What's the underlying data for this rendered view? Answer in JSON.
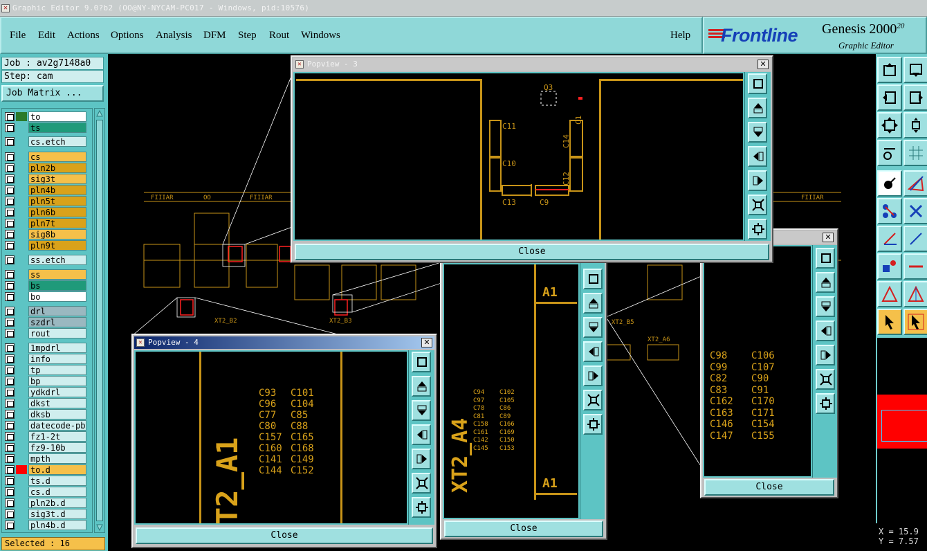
{
  "window": {
    "title": "Graphic Editor 9.0?b2  (OO@NY-NYCAM-PC017 - Windows, pid:10576)"
  },
  "menu": {
    "items": [
      "File",
      "Edit",
      "Actions",
      "Options",
      "Analysis",
      "DFM",
      "Step",
      "Rout",
      "Windows"
    ],
    "help": "Help"
  },
  "brand": {
    "logo": "Frontline",
    "product": "Genesis 2000",
    "product_suffix": "20",
    "subtitle": "Graphic Editor"
  },
  "job": {
    "job_label": "Job : av2g7148a0",
    "step_label": "Step: cam",
    "matrix_button": "Job Matrix ..."
  },
  "layers": [
    {
      "name": "to",
      "color": "#ffffff"
    },
    {
      "name": "ts",
      "color": "#1f9a7a"
    },
    {
      "name": "cs.etch",
      "color": "#cfeeee"
    },
    {
      "name": "cs",
      "color": "#f5c04a"
    },
    {
      "name": "pln2b",
      "color": "#d9a21a"
    },
    {
      "name": "sig3t",
      "color": "#f5c04a"
    },
    {
      "name": "pln4b",
      "color": "#d9a21a"
    },
    {
      "name": "pln5t",
      "color": "#d9a21a"
    },
    {
      "name": "pln6b",
      "color": "#d9a21a"
    },
    {
      "name": "pln7t",
      "color": "#d9a21a"
    },
    {
      "name": "sig8b",
      "color": "#f5c04a"
    },
    {
      "name": "pln9t",
      "color": "#d9a21a"
    },
    {
      "name": "ss.etch",
      "color": "#cfeeee"
    },
    {
      "name": "ss",
      "color": "#f5c04a"
    },
    {
      "name": "bs",
      "color": "#1f9a7a"
    },
    {
      "name": "bo",
      "color": "#ffffff"
    },
    {
      "name": "drl",
      "color": "#9ab8c0"
    },
    {
      "name": "szdrl",
      "color": "#9ab8c0"
    },
    {
      "name": "rout",
      "color": "#cfeeee"
    },
    {
      "name": "1mpdrl",
      "color": "#cfeeee"
    },
    {
      "name": "info",
      "color": "#cfeeee"
    },
    {
      "name": "tp",
      "color": "#cfeeee"
    },
    {
      "name": "bp",
      "color": "#cfeeee"
    },
    {
      "name": "ydkdrl",
      "color": "#cfeeee"
    },
    {
      "name": "dkst",
      "color": "#cfeeee"
    },
    {
      "name": "dksb",
      "color": "#cfeeee"
    },
    {
      "name": "datecode-pbe",
      "color": "#cfeeee"
    },
    {
      "name": "fz1-2t",
      "color": "#cfeeee"
    },
    {
      "name": "fz9-10b",
      "color": "#cfeeee"
    },
    {
      "name": "mpth",
      "color": "#cfeeee"
    },
    {
      "name": "to.d",
      "color": "#f5c04a"
    },
    {
      "name": "ts.d",
      "color": "#cfeeee"
    },
    {
      "name": "cs.d",
      "color": "#cfeeee"
    },
    {
      "name": "pln2b.d",
      "color": "#cfeeee"
    },
    {
      "name": "sig3t.d",
      "color": "#cfeeee"
    },
    {
      "name": "pln4b.d",
      "color": "#cfeeee"
    }
  ],
  "status": {
    "selected": "Selected : 16",
    "x": "X = 15.9",
    "y": "Y = 7.57"
  },
  "popups": {
    "p3": {
      "title": "Popview - 3",
      "close": "Close",
      "labels": {
        "q3": "Q3",
        "c1": "C1",
        "c11": "C11",
        "c14": "C14",
        "c10": "C10",
        "c12": "C12",
        "c13": "C13",
        "c9": "C9"
      }
    },
    "p4": {
      "title": "Popview - 4",
      "close": "Close",
      "big": "T2_A1",
      "col1": [
        "C93",
        "C96",
        "C77",
        "C80",
        "C157",
        "C160",
        "C141",
        "C144"
      ],
      "col2": [
        "C101",
        "C104",
        "C85",
        "C88",
        "C165",
        "C168",
        "C149",
        "C152"
      ]
    },
    "p5": {
      "close": "Close",
      "a1_top": "A1",
      "a1_bottom": "A1",
      "big": "XT2_A4",
      "col1": [
        "C94",
        "C97",
        "C78",
        "C81",
        "C158",
        "C161",
        "C142",
        "C145"
      ],
      "col2": [
        "C102",
        "C105",
        "C86",
        "C89",
        "C166",
        "C169",
        "C150",
        "C153"
      ]
    },
    "p6": {
      "close": "Close",
      "col1": [
        "C98",
        "C99",
        "C82",
        "C83",
        "C162",
        "C163",
        "C146",
        "C147"
      ],
      "col2": [
        "C106",
        "C107",
        "C90",
        "C91",
        "C170",
        "C171",
        "C154",
        "C155"
      ]
    }
  },
  "colors": {
    "accent": "#8fd8d8",
    "trace": "#c89418",
    "highlight": "#ff0000",
    "panel": "#5dc4c4"
  }
}
